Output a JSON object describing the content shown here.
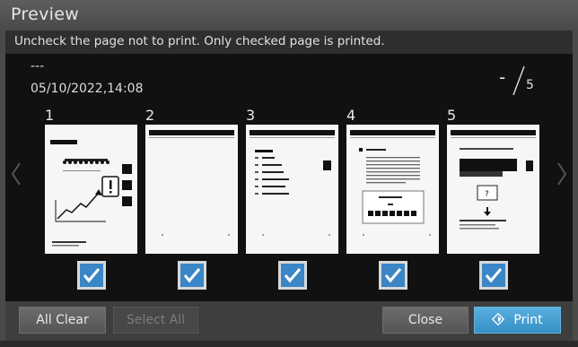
{
  "window": {
    "title": "Preview"
  },
  "instruction": "Uncheck the page not to print. Only checked page is printed.",
  "job": {
    "name": "---",
    "datetime": "05/10/2022,14:08"
  },
  "page_counter": {
    "current": "-",
    "total": "5"
  },
  "nav": {
    "prev_icon": "chevron-left-icon",
    "next_icon": "chevron-right-icon"
  },
  "pages": [
    {
      "number": "1",
      "checked": true
    },
    {
      "number": "2",
      "checked": true
    },
    {
      "number": "3",
      "checked": true
    },
    {
      "number": "4",
      "checked": true
    },
    {
      "number": "5",
      "checked": true
    }
  ],
  "buttons": {
    "all_clear": "All Clear",
    "select_all": "Select All",
    "close": "Close",
    "print": "Print"
  },
  "colors": {
    "accent": "#3a86c6",
    "print_button": "#45a2d6",
    "background": "#111111"
  }
}
